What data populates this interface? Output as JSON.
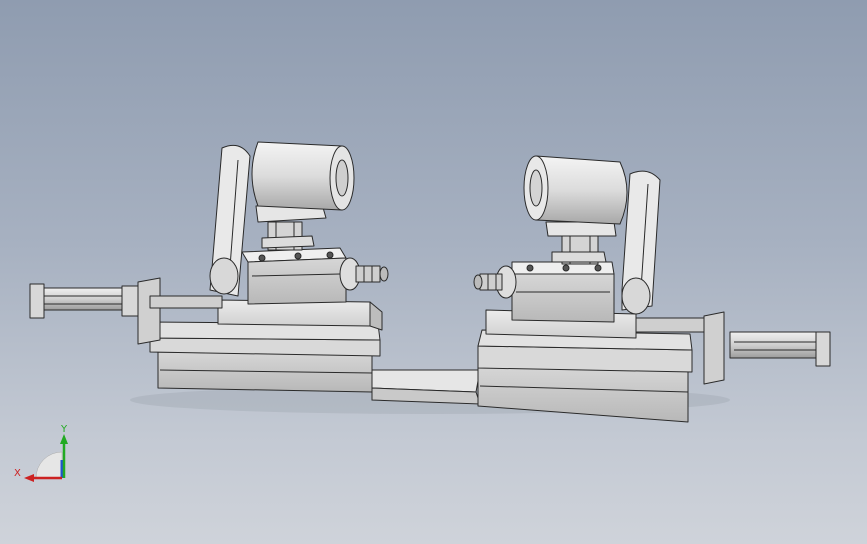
{
  "viewport": {
    "background_top": "#8f9cb0",
    "background_bottom": "#cfd3da"
  },
  "model": {
    "part_color": "#d4d4d4",
    "shadow_color": "#a9a9a9",
    "edge_color": "#2a2a2a"
  },
  "triad": {
    "x_label": "X",
    "y_label": "Y",
    "x_color": "#cc2222",
    "y_color": "#22aa22",
    "z_color": "#2255cc"
  }
}
